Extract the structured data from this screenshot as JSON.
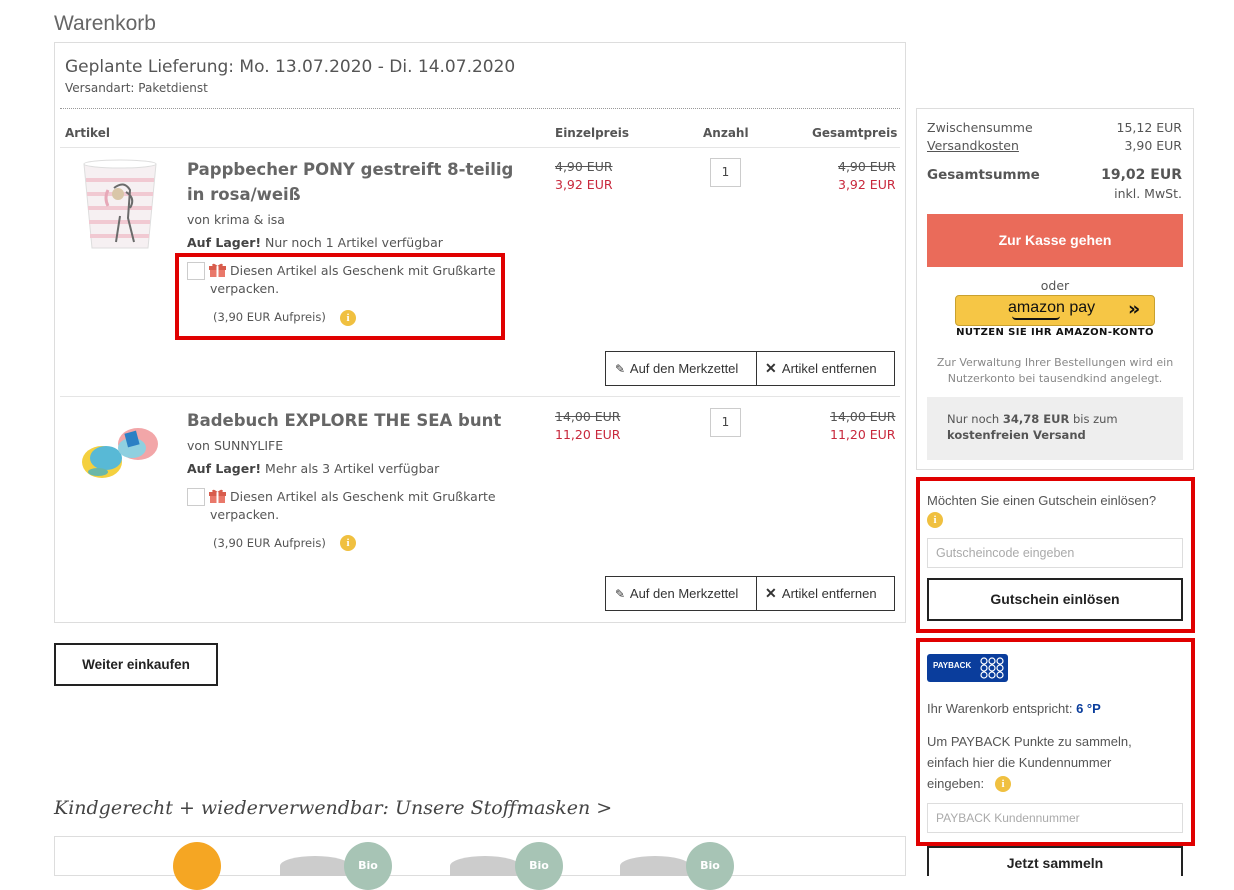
{
  "page_title": "Warenkorb",
  "delivery": {
    "title": "Geplante Lieferung: Mo. 13.07.2020 - Di. 14.07.2020",
    "shipping_method": "Versandart: Paketdienst"
  },
  "columns": {
    "article": "Artikel",
    "unit_price": "Einzelpreis",
    "quantity": "Anzahl",
    "total_price": "Gesamtpreis"
  },
  "items": [
    {
      "title": "Pappbecher PONY gestreift 8-teilig in rosa/weiß",
      "vendor": "von krima & isa",
      "stock_bold": "Auf Lager!",
      "stock_text": " Nur noch 1 Artikel verfügbar",
      "gift_text": "Diesen Artikel als Geschenk mit Grußkarte verpacken.",
      "gift_surcharge": "(3,90 EUR Aufpreis)",
      "old_price": "4,90 EUR",
      "new_price": "3,92 EUR",
      "quantity": "1",
      "total_old": "4,90 EUR",
      "total_new": "3,92 EUR"
    },
    {
      "title": "Badebuch EXPLORE THE SEA bunt",
      "vendor": "von SUNNYLIFE",
      "stock_bold": "Auf Lager!",
      "stock_text": " Mehr als 3 Artikel verfügbar",
      "gift_text": "Diesen Artikel als Geschenk mit Grußkarte verpacken.",
      "gift_surcharge": "(3,90 EUR Aufpreis)",
      "old_price": "14,00 EUR",
      "new_price": "11,20 EUR",
      "quantity": "1",
      "total_old": "14,00 EUR",
      "total_new": "11,20 EUR"
    }
  ],
  "actions": {
    "wishlist": "Auf den Merkzettel",
    "remove": "Artikel entfernen"
  },
  "continue_shopping": "Weiter einkaufen",
  "summary": {
    "subtotal_label": "Zwischensumme",
    "subtotal_value": "15,12 EUR",
    "shipping_label": "Versandkosten",
    "shipping_value": "3,90 EUR",
    "total_label": "Gesamtsumme",
    "total_value": "19,02 EUR",
    "vat_note": "inkl. MwSt.",
    "checkout": "Zur Kasse gehen",
    "or": "oder",
    "amazon_brand": "amazon pay",
    "amazon_sub": "NUTZEN SIE IHR AMAZON-KONTO",
    "account_note": "Zur Verwaltung Ihrer Bestellungen wird ein Nutzerkonto bei tausendkind angelegt.",
    "free_ship_prefix": "Nur noch ",
    "free_ship_amount": "34,78 EUR",
    "free_ship_mid": " bis zum ",
    "free_ship_bold": "kostenfreien Versand"
  },
  "voucher": {
    "question": "Möchten Sie einen Gutschein einlösen?",
    "placeholder": "Gutscheincode eingeben",
    "button": "Gutschein einlösen"
  },
  "payback": {
    "logo_text": "PAYBACK",
    "points_label": "Ihr Warenkorb entspricht: ",
    "points_value": "6 °P",
    "instructions": "Um PAYBACK Punkte zu sammeln, einfach hier die Kundennummer eingeben:",
    "placeholder": "PAYBACK Kundennummer",
    "button": "Jetzt sammeln"
  },
  "masks_title": "Kindgerecht + wiederverwendbar: Unsere Stoffmasken >",
  "masks_badge": "Bio",
  "colors": {
    "accent": "#ea6b5a",
    "price_red": "#c8283c",
    "highlight": "#e00000",
    "payback_blue": "#0a3d9c",
    "amazon_yellow": "#f6c645"
  }
}
